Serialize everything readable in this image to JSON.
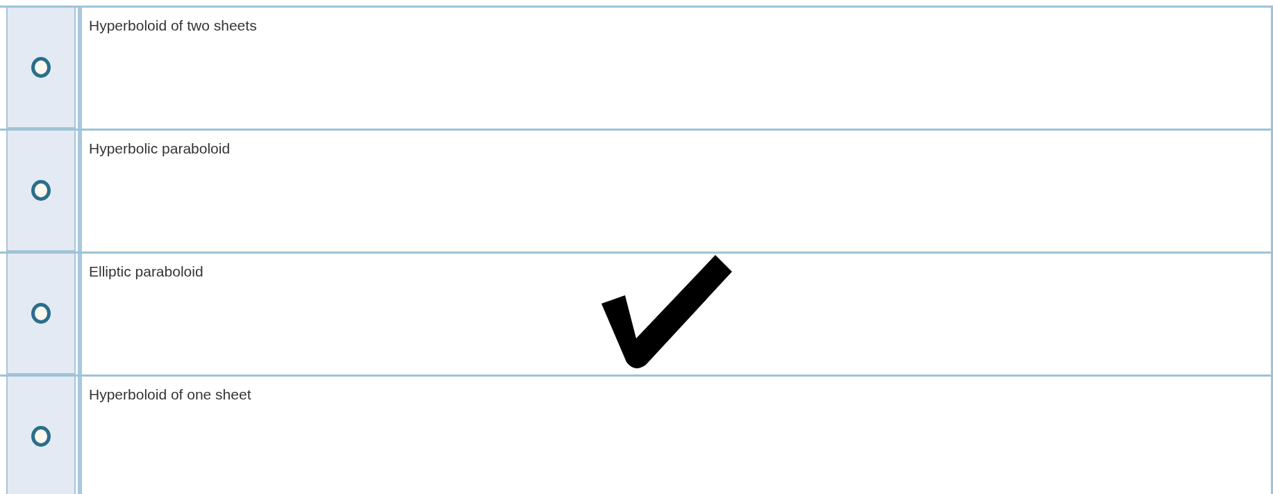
{
  "options": [
    {
      "text": "Hyperboloid of two sheets",
      "selected": false,
      "marked_correct": false
    },
    {
      "text": "Hyperbolic paraboloid",
      "selected": false,
      "marked_correct": false
    },
    {
      "text": "Elliptic paraboloid",
      "selected": false,
      "marked_correct": true
    },
    {
      "text": "Hyperboloid of one sheet",
      "selected": false,
      "marked_correct": false
    }
  ]
}
